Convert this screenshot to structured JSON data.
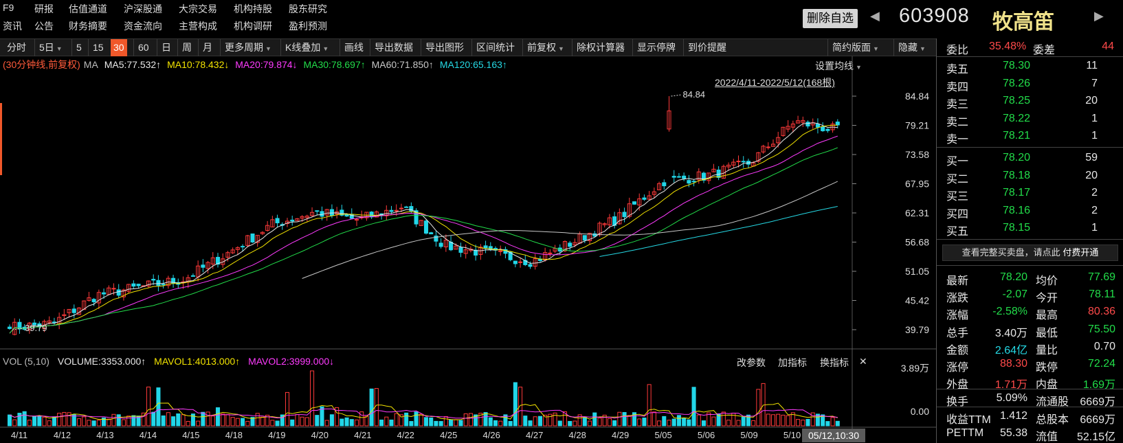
{
  "header": {
    "menu_row1": [
      "F9",
      "研报",
      "估值通道",
      "沪深股通",
      "大宗交易",
      "机构持股",
      "股东研究"
    ],
    "menu_row2": [
      "资讯",
      "公告",
      "财务摘要",
      "资金流向",
      "主营构成",
      "机构调研",
      "盈利预测"
    ],
    "delete_watchlist": "删除自选",
    "prev_arrow": "◀",
    "next_arrow": "▶",
    "stock_code": "603908",
    "stock_name": "牧高笛"
  },
  "toolbar": {
    "items": [
      "分时",
      "5日",
      "5",
      "15",
      "30",
      "60",
      "日",
      "周",
      "月",
      "更多周期",
      "K线叠加",
      "画线",
      "导出数据",
      "导出图形",
      "区间统计",
      "前复权",
      "除权计算器",
      "显示停牌",
      "到价提醒",
      "简约版面",
      "隐藏"
    ],
    "active": "30"
  },
  "chart": {
    "ma_prefix": "(30分钟线,前复权)",
    "ma_label": "MA",
    "ma_items": [
      {
        "text": "MA5:77.532↑",
        "color": "#e8e8e8"
      },
      {
        "text": "MA10:78.432↓",
        "color": "#f3e400"
      },
      {
        "text": "MA20:79.874↓",
        "color": "#ff3bff"
      },
      {
        "text": "MA30:78.697↑",
        "color": "#22dd4a"
      },
      {
        "text": "MA60:71.850↑",
        "color": "#c8c8c8"
      },
      {
        "text": "MA120:65.163↑",
        "color": "#25d9e5"
      }
    ],
    "setting_ma": "设置均线",
    "date_range": "2022/4/11-2022/5/12(168根)",
    "high_label": "84.84",
    "low_label": "39.79",
    "price_ticks": [
      "84.84",
      "79.21",
      "73.58",
      "67.95",
      "62.31",
      "56.68",
      "51.05",
      "45.42",
      "39.79"
    ],
    "vol_ticks": [
      "3.89万",
      "0.00"
    ],
    "x_labels": [
      "4/11",
      "4/12",
      "4/13",
      "4/14",
      "4/15",
      "4/18",
      "4/19",
      "4/20",
      "4/21",
      "4/22",
      "4/25",
      "4/26",
      "4/27",
      "4/28",
      "4/29",
      "5/05",
      "5/06",
      "5/09",
      "5/10",
      "5/"
    ],
    "cursor_time": "05/12,10:30",
    "vol_legend": [
      {
        "text": "VOL (5,10)",
        "color": "#bbb"
      },
      {
        "text": "VOLUME:3353.000↑",
        "color": "#e8e8e8"
      },
      {
        "text": "MAVOL1:4013.000↑",
        "color": "#f3e400"
      },
      {
        "text": "MAVOL2:3999.000↓",
        "color": "#ff3bff"
      }
    ],
    "vol_buttons": [
      "改参数",
      "加指标",
      "换指标",
      "✕"
    ]
  },
  "chart_data": {
    "type": "candlestick",
    "interval": "30min",
    "ylim": [
      39.79,
      84.84
    ],
    "close_path": [
      [
        "4/11",
        40.2
      ],
      [
        "4/12",
        41.0
      ],
      [
        "4/13",
        46.5
      ],
      [
        "4/14",
        48.0
      ],
      [
        "4/15",
        49.5
      ],
      [
        "4/18",
        54.5
      ],
      [
        "4/19",
        60.0
      ],
      [
        "4/20",
        62.5
      ],
      [
        "4/21",
        61.0
      ],
      [
        "4/22",
        63.5
      ],
      [
        "4/25",
        56.0
      ],
      [
        "4/26",
        54.5
      ],
      [
        "4/27",
        53.0
      ],
      [
        "4/28",
        57.0
      ],
      [
        "4/29",
        61.5
      ],
      [
        "5/05",
        68.5
      ],
      [
        "5/06",
        69.5
      ],
      [
        "5/09",
        72.0
      ],
      [
        "5/10",
        80.0
      ],
      [
        "5/12",
        78.2
      ]
    ]
  },
  "quote": {
    "weibi_label": "委比",
    "weibi": "35.48%",
    "weicha_label": "委差",
    "weicha": "44",
    "asks": [
      {
        "label": "卖五",
        "price": "78.30",
        "vol": "11"
      },
      {
        "label": "卖四",
        "price": "78.26",
        "vol": "7"
      },
      {
        "label": "卖三",
        "price": "78.25",
        "vol": "20"
      },
      {
        "label": "卖二",
        "price": "78.22",
        "vol": "1"
      },
      {
        "label": "卖一",
        "price": "78.21",
        "vol": "1"
      }
    ],
    "bids": [
      {
        "label": "买一",
        "price": "78.20",
        "vol": "59"
      },
      {
        "label": "买二",
        "price": "78.18",
        "vol": "20"
      },
      {
        "label": "买三",
        "price": "78.17",
        "vol": "2"
      },
      {
        "label": "买四",
        "price": "78.16",
        "vol": "2"
      },
      {
        "label": "买五",
        "price": "78.15",
        "vol": "1"
      }
    ],
    "fee_text": "查看完整买卖盘，请点此",
    "fee_link": "付费开通",
    "stats": [
      {
        "l1": "最新",
        "v1": "78.20",
        "c1": "green",
        "l2": "均价",
        "v2": "77.69",
        "c2": "green"
      },
      {
        "l1": "涨跌",
        "v1": "-2.07",
        "c1": "green",
        "l2": "今开",
        "v2": "78.11",
        "c2": "green"
      },
      {
        "l1": "涨幅",
        "v1": "-2.58%",
        "c1": "green",
        "l2": "最高",
        "v2": "80.36",
        "c2": "red"
      },
      {
        "l1": "总手",
        "v1": "3.40万",
        "c1": "white",
        "l2": "最低",
        "v2": "75.50",
        "c2": "green"
      },
      {
        "l1": "金额",
        "v1": "2.64亿",
        "c1": "cyan",
        "l2": "量比",
        "v2": "0.70",
        "c2": "white"
      },
      {
        "l1": "涨停",
        "v1": "88.30",
        "c1": "red",
        "l2": "跌停",
        "v2": "72.24",
        "c2": "green"
      },
      {
        "l1": "外盘",
        "v1": "1.71万",
        "c1": "red",
        "l2": "内盘",
        "v2": "1.69万",
        "c2": "green"
      },
      {
        "l1": "换手",
        "v1": "5.09%",
        "c1": "white",
        "l2": "流通股",
        "v2": "6669万",
        "c2": "white"
      },
      {
        "l1": "收益TTM",
        "v1": "1.412",
        "c1": "white",
        "l2": "总股本",
        "v2": "6669万",
        "c2": "white"
      },
      {
        "l1": "PETTM",
        "v1": "55.38",
        "c1": "white",
        "l2": "流值",
        "v2": "52.15亿",
        "c2": "white"
      }
    ]
  }
}
